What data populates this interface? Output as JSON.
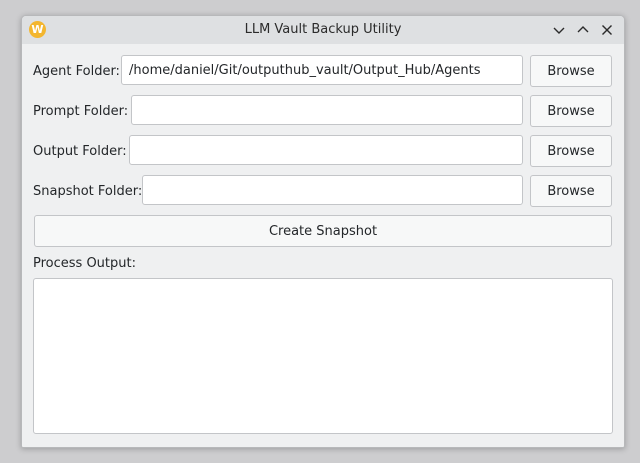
{
  "window": {
    "title": "LLM Vault Backup Utility",
    "app_icon_glyph": "W",
    "controls": [
      "minimize-icon",
      "maximize-icon",
      "close-icon"
    ]
  },
  "rows": [
    {
      "label": "Agent Folder:",
      "value": "/home/daniel/Git/outputhub_vault/Output_Hub/Agents",
      "button": "Browse"
    },
    {
      "label": "Prompt Folder:",
      "value": "",
      "button": "Browse"
    },
    {
      "label": "Output Folder:",
      "value": "",
      "button": "Browse"
    },
    {
      "label": "Snapshot Folder:",
      "value": "",
      "button": "Browse"
    }
  ],
  "actions": {
    "create_snapshot": "Create Snapshot"
  },
  "output": {
    "label": "Process Output:",
    "value": ""
  },
  "colors": {
    "window_bg": "#eff0f1",
    "titlebar_bg": "#dee0e2",
    "app_icon": "#f3b62f"
  }
}
